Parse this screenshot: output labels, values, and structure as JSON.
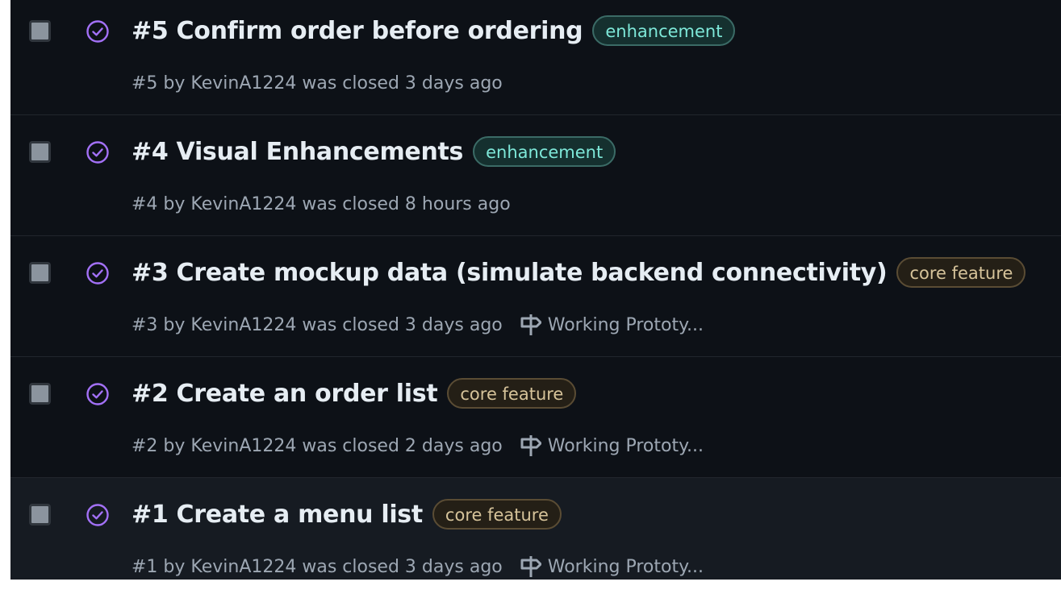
{
  "colors": {
    "background": "#0d1117",
    "hover_row": "#161b22",
    "closed_icon": "#a371f7",
    "title": "#e6edf3",
    "meta": "#9da7b3",
    "enhancement_label": "#7ee8d9",
    "core_feature_label": "#d6c39a"
  },
  "issues": [
    {
      "title": "#5 Confirm order before ordering",
      "label": "enhancement",
      "meta": "#5 by KevinA1224 was closed 3 days ago",
      "milestone": ""
    },
    {
      "title": "#4 Visual Enhancements",
      "label": "enhancement",
      "meta": "#4 by KevinA1224 was closed 8 hours ago",
      "milestone": ""
    },
    {
      "title": "#3 Create mockup data (simulate backend connectivity)",
      "label": "core feature",
      "meta": "#3 by KevinA1224 was closed 3 days ago",
      "milestone": "Working Prototy..."
    },
    {
      "title": "#2 Create an order list",
      "label": "core feature",
      "meta": "#2 by KevinA1224 was closed 2 days ago",
      "milestone": "Working Prototy..."
    },
    {
      "title": "#1 Create a menu list",
      "label": "core feature",
      "meta": "#1 by KevinA1224 was closed 3 days ago",
      "milestone": "Working Prototy..."
    }
  ],
  "icons": {
    "state": "issue-closed-icon",
    "milestone": "milestone-icon",
    "checkbox": "checkbox"
  }
}
